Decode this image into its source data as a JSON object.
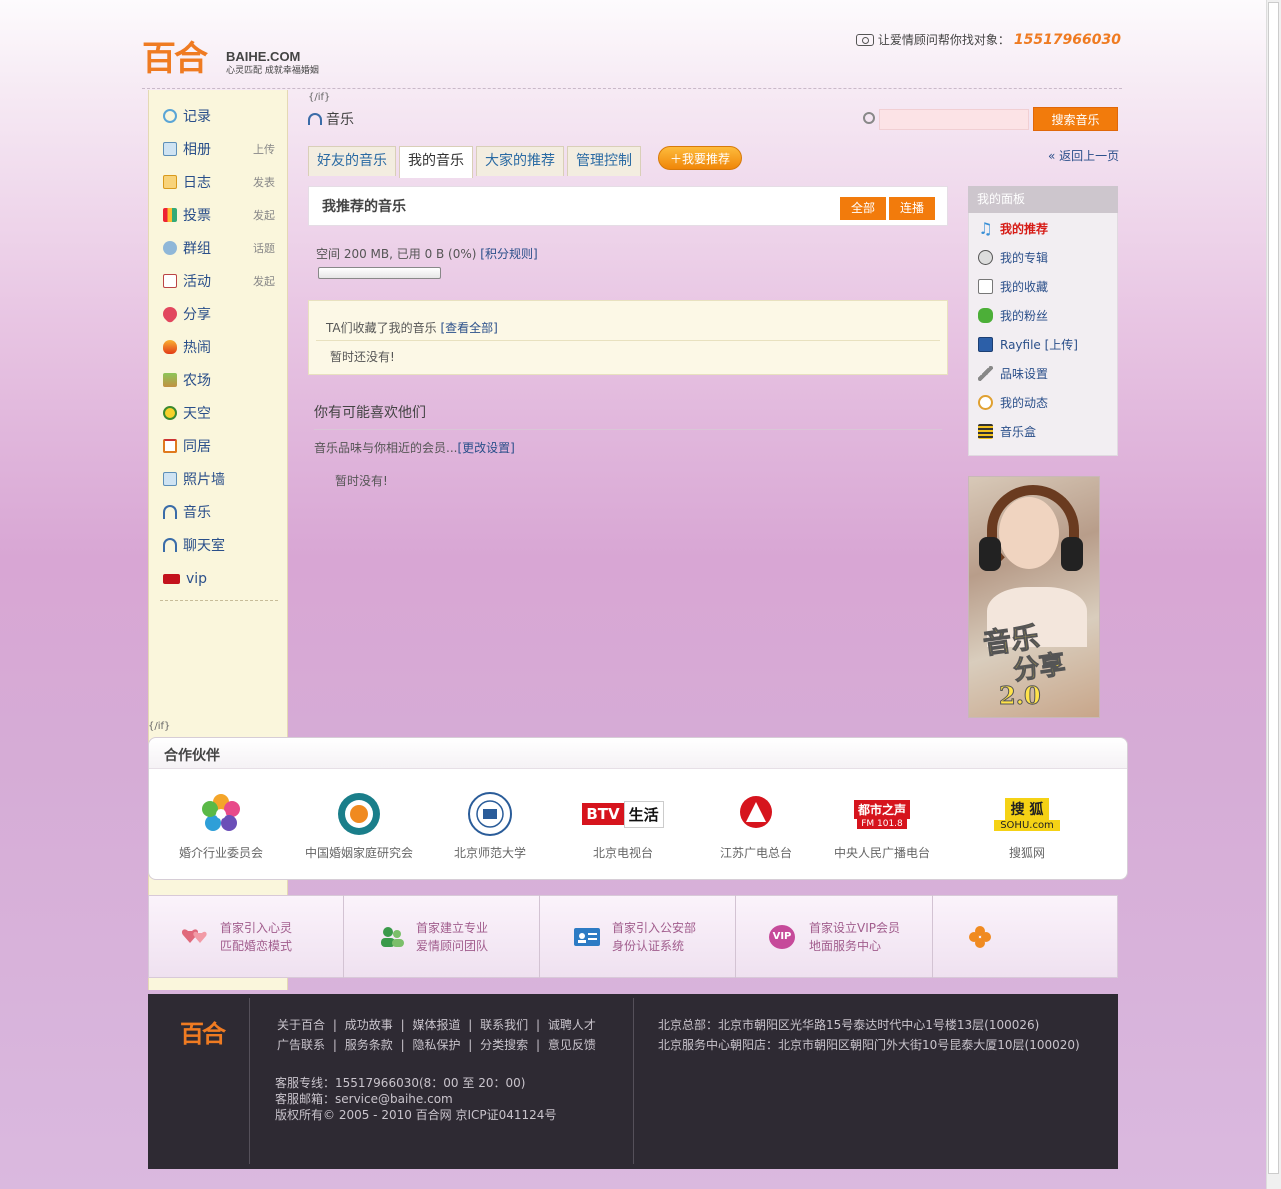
{
  "header": {
    "logo_cn": "百合",
    "logo_en": "BAIHE.COM",
    "logo_tagline": "心灵匹配 成就幸福婚姻",
    "hotline_label": "让爱情顾问帮你找对象：",
    "hotline_number": "15517966030"
  },
  "sidebar": {
    "items": [
      {
        "label": "记录",
        "sub": ""
      },
      {
        "label": "相册",
        "sub": "上传"
      },
      {
        "label": "日志",
        "sub": "发表"
      },
      {
        "label": "投票",
        "sub": "发起"
      },
      {
        "label": "群组",
        "sub": "话题"
      },
      {
        "label": "活动",
        "sub": "发起"
      },
      {
        "label": "分享",
        "sub": ""
      },
      {
        "label": "热闹",
        "sub": ""
      },
      {
        "label": "农场",
        "sub": ""
      },
      {
        "label": "天空",
        "sub": ""
      },
      {
        "label": "同居",
        "sub": ""
      },
      {
        "label": "照片墙",
        "sub": ""
      },
      {
        "label": "音乐",
        "sub": ""
      },
      {
        "label": "聊天室",
        "sub": ""
      },
      {
        "label": "vip",
        "sub": ""
      }
    ],
    "if_tag": "{/if}"
  },
  "main": {
    "if_tag": "{/if}",
    "section_title": "音乐",
    "search_button": "搜索音乐",
    "search_value": "",
    "tabs": [
      {
        "label": "好友的音乐"
      },
      {
        "label": "我的音乐"
      },
      {
        "label": "大家的推荐"
      },
      {
        "label": "管理控制"
      }
    ],
    "recommend_button": "我要推荐",
    "back_link": "返回上一页",
    "my_rec_title": "我推荐的音乐",
    "btn_all": "全部",
    "btn_play": "连播",
    "storage_text": "空间  200 MB, 已用  0 B (0%)",
    "storage_link": "[积分规则]",
    "collect_title": "TA们收藏了我的音乐",
    "collect_link": "[查看全部]",
    "collect_empty": "暂时还没有!",
    "maylike_title": "你有可能喜欢他们",
    "maylike_desc": "音乐品味与你相近的会员...",
    "maylike_link": "[更改设置]",
    "maylike_empty": "暂时没有!"
  },
  "panel": {
    "title": "我的面板",
    "items": [
      {
        "label": "我的推荐"
      },
      {
        "label": "我的专辑"
      },
      {
        "label": "我的收藏"
      },
      {
        "label": "我的粉丝"
      },
      {
        "label": "Rayfile [上传]"
      },
      {
        "label": "品味设置"
      },
      {
        "label": "我的动态"
      },
      {
        "label": "音乐盒"
      }
    ]
  },
  "ad": {
    "line1": "音乐",
    "line2": "分享",
    "line3": "2.0"
  },
  "partners": {
    "title": "合作伙伴",
    "items": [
      {
        "name": "婚介行业委员会"
      },
      {
        "name": "中国婚姻家庭研究会"
      },
      {
        "name": "北京师范大学"
      },
      {
        "name": "北京电视台",
        "logo_text_a": "BTV",
        "logo_text_b": "生活"
      },
      {
        "name": "江苏广电总台"
      },
      {
        "name": "中央人民广播电台",
        "logo_text_a": "都市之声",
        "logo_text_b": "FM 101.8"
      },
      {
        "name": "搜狐网",
        "logo_text_a": "搜  狐",
        "logo_text_b": "SOHU.com"
      }
    ]
  },
  "features": [
    {
      "line1": "首家引入心灵",
      "line2": "匹配婚恋模式"
    },
    {
      "line1": "首家建立专业",
      "line2": "爱情顾问团队"
    },
    {
      "line1": "首家引入公安部",
      "line2": "身份认证系统"
    },
    {
      "line1": "首家设立VIP会员",
      "line2": "地面服务中心",
      "icon_text": "VIP"
    }
  ],
  "footer": {
    "logo": "百合",
    "links_row1": [
      "关于百合",
      "|",
      "成功故事",
      "|",
      "媒体报道",
      "|",
      "联系我们",
      "|",
      "诚聘人才"
    ],
    "links_row2": [
      "广告联系",
      "|",
      "服务条款",
      "|",
      "隐私保护",
      "|",
      "分类搜索",
      "|",
      "意见反馈"
    ],
    "service_phone": "客服专线：15517966030(8：00 至  20：00)",
    "service_email": "客服邮箱：service@baihe.com",
    "copyright": "版权所有© 2005 - 2010 百合网    京ICP证041124号",
    "address1": "北京总部：北京市朝阳区光华路15号泰达时代中心1号楼13层(100026)",
    "address2": "北京服务中心朝阳店：北京市朝阳区朝阳门外大街10号昆泰大厦10层(100020)"
  },
  "colors": {
    "brand_orange": "#ef7b22",
    "button_orange": "#f27b0c",
    "link_blue": "#2a4f8a",
    "active_red": "#d61b16"
  }
}
